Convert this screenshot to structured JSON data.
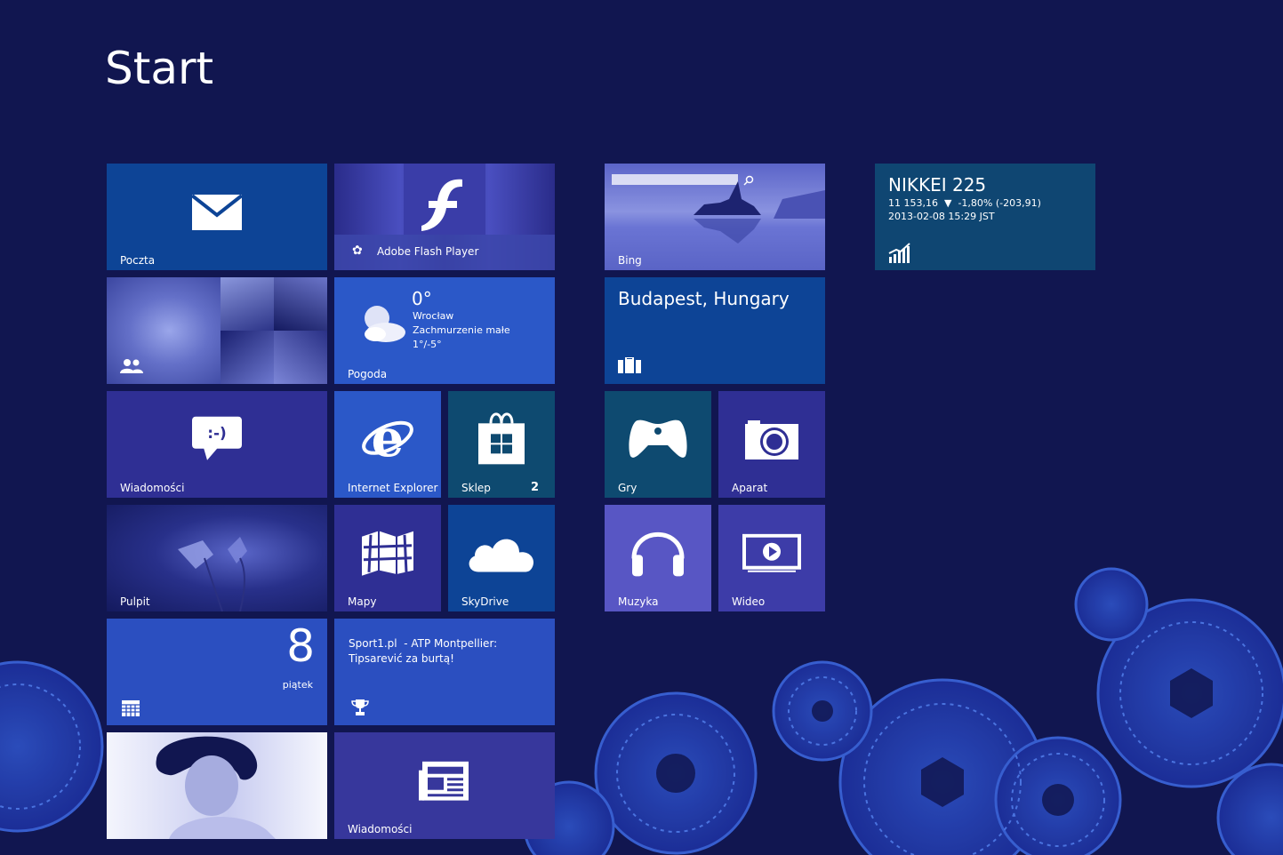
{
  "title": "Start",
  "colors": {
    "background": "#111650",
    "tile_blue": "#0d4496",
    "tile_purple": "#2f2f94",
    "tile_bright": "#2b58c8",
    "tile_teal": "#0d3a6a"
  },
  "tiles": {
    "mail": {
      "label": "Poczta",
      "icon": "mail-icon"
    },
    "flash": {
      "label": "Adobe Flash Player",
      "icon": "flash-icon"
    },
    "bing": {
      "label": "Bing",
      "icon": "search-icon"
    },
    "finance": {
      "title": "NIKKEI 225",
      "line1_value": "11 153,16",
      "line1_change": "-1,80% (-203,91)",
      "line2": "2013-02-08 15:29 JST",
      "icon": "chart-icon"
    },
    "people": {
      "icon": "people-icon"
    },
    "weather": {
      "temp": "0°",
      "city": "Wrocław",
      "condition": "Zachmurzenie małe",
      "range": "1°/-5°",
      "label": "Pogoda",
      "icon": "cloud-sun-icon"
    },
    "travel": {
      "title": "Budapest, Hungary",
      "icon": "suitcase-icon"
    },
    "messaging": {
      "label": "Wiadomości",
      "emoticon": ":-)",
      "icon": "chat-bubble-icon"
    },
    "ie": {
      "label": "Internet Explorer",
      "icon": "ie-icon"
    },
    "store": {
      "label": "Sklep",
      "badge": "2",
      "icon": "store-bag-icon"
    },
    "games": {
      "label": "Gry",
      "icon": "gamepad-icon"
    },
    "camera": {
      "label": "Aparat",
      "icon": "camera-icon"
    },
    "desktop": {
      "label": "Pulpit"
    },
    "maps": {
      "label": "Mapy",
      "icon": "map-icon"
    },
    "skydrive": {
      "label": "SkyDrive",
      "icon": "cloud-icon"
    },
    "music": {
      "label": "Muzyka",
      "icon": "headphones-icon"
    },
    "video": {
      "label": "Wideo",
      "icon": "play-icon"
    },
    "calendar": {
      "day_number": "8",
      "day_name": "piątek",
      "icon": "calendar-icon"
    },
    "sport": {
      "headline": "Sport1.pl  - ATP Montpellier: Tipsarević za burtą!",
      "icon": "trophy-icon"
    },
    "photos": {},
    "news": {
      "label": "Wiadomości",
      "icon": "newspaper-icon"
    }
  }
}
